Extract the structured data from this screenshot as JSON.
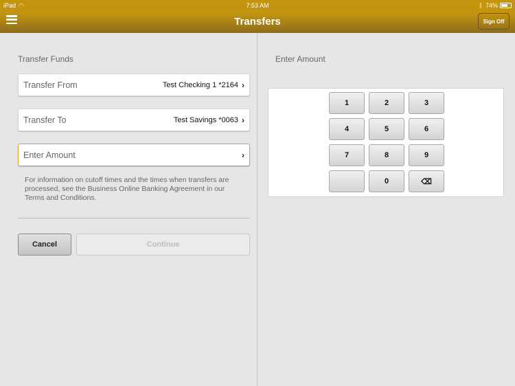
{
  "status": {
    "device": "iPad",
    "time": "7:53 AM",
    "battery": "74%"
  },
  "header": {
    "title": "Transfers",
    "sign_off": "Sign Off"
  },
  "left": {
    "section": "Transfer Funds",
    "from": {
      "label": "Transfer From",
      "value": "Test Checking 1 *2164"
    },
    "to": {
      "label": "Transfer To",
      "value": "Test Savings *0063"
    },
    "amount": {
      "label": "Enter Amount"
    },
    "info": "For information on cutoff times and the times when transfers are processed, see the Business Online Banking Agreement in our Terms and Conditions.",
    "cancel": "Cancel",
    "continue": "Continue"
  },
  "right": {
    "section": "Enter Amount",
    "keys": [
      "1",
      "2",
      "3",
      "4",
      "5",
      "6",
      "7",
      "8",
      "9",
      "",
      "0",
      "⌫"
    ]
  },
  "colors": {
    "header": "#c4950c",
    "active_border": "#d1a838"
  }
}
